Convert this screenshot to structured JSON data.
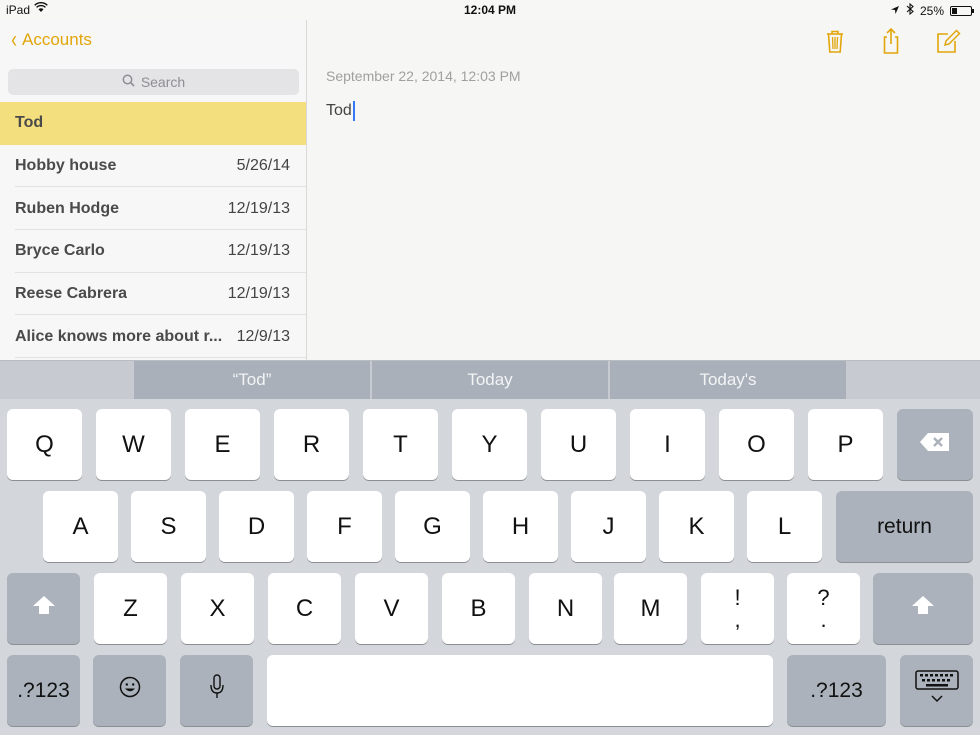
{
  "status_bar": {
    "device": "iPad",
    "time": "12:04 PM",
    "battery": "25%",
    "battery_level": 0.25
  },
  "sidebar": {
    "back_label": "Accounts",
    "search_placeholder": "Search",
    "notes": [
      {
        "title": "Tod",
        "date": "",
        "selected": true
      },
      {
        "title": "Hobby house",
        "date": "5/26/14"
      },
      {
        "title": "Ruben Hodge",
        "date": "12/19/13"
      },
      {
        "title": "Bryce Carlo",
        "date": "12/19/13"
      },
      {
        "title": "Reese Cabrera",
        "date": "12/19/13"
      },
      {
        "title": "Alice knows more about r...",
        "date": "12/9/13"
      }
    ]
  },
  "note": {
    "timestamp": "September 22, 2014, 12:03 PM",
    "text": "Tod"
  },
  "colors": {
    "accent": "#e2a60b",
    "selected_row": "#f3df7d",
    "keyboard_bg": "#d3d6db",
    "dark_key": "#abb2bb"
  },
  "keyboard": {
    "suggestions": [
      "“Tod”",
      "Today",
      "Today's"
    ],
    "row1": [
      "Q",
      "W",
      "E",
      "R",
      "T",
      "Y",
      "U",
      "I",
      "O",
      "P"
    ],
    "row2": [
      "A",
      "S",
      "D",
      "F",
      "G",
      "H",
      "J",
      "K",
      "L"
    ],
    "row3": [
      "Z",
      "X",
      "C",
      "V",
      "B",
      "N",
      "M"
    ],
    "punct1": [
      "!",
      ","
    ],
    "punct2": [
      "?",
      "."
    ],
    "return_label": "return",
    "numbers_label": ".?123",
    "icons": {
      "backspace": "backspace-icon",
      "shift": "shift-icon",
      "emoji": "emoji-icon",
      "mic": "microphone-icon",
      "dismiss": "keyboard-dismiss-icon"
    }
  }
}
